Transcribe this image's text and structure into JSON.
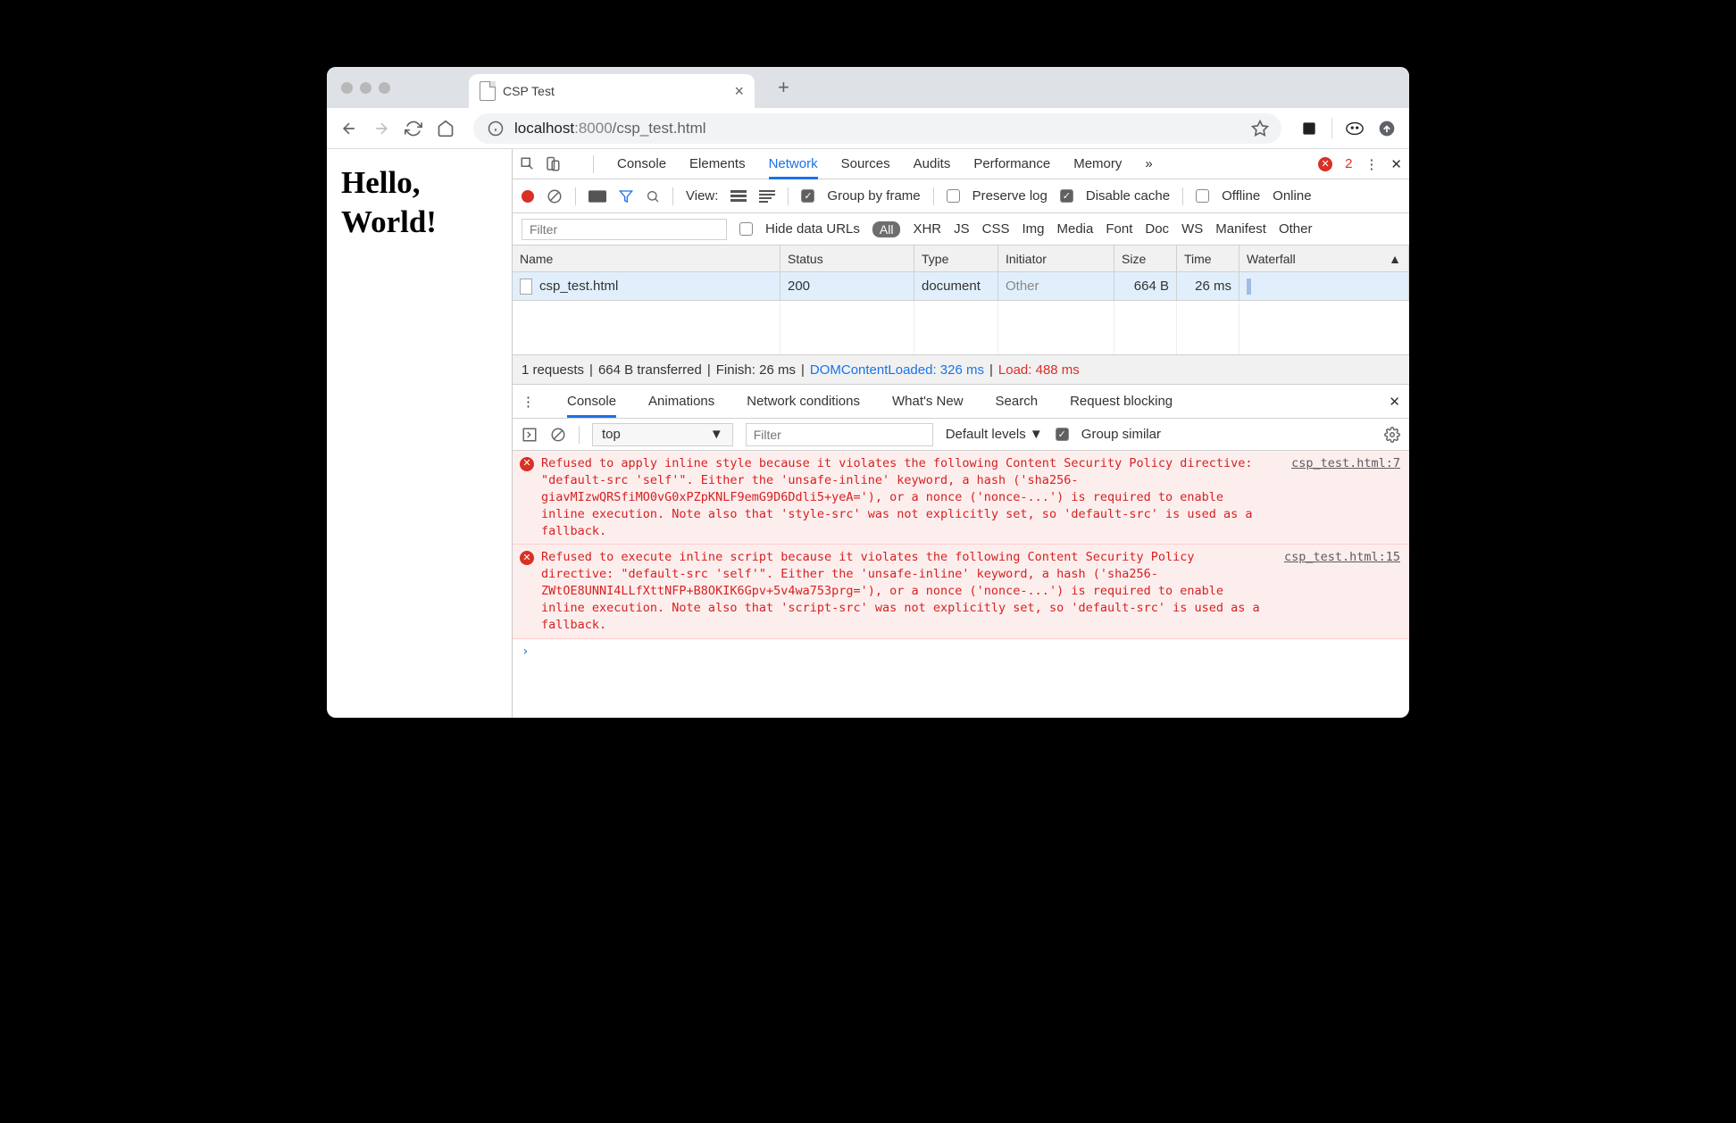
{
  "tab": {
    "title": "CSP Test"
  },
  "address": {
    "host": "localhost",
    "port": ":8000",
    "path": "/csp_test.html"
  },
  "page": {
    "heading_line1": "Hello,",
    "heading_line2": "World!"
  },
  "devtools": {
    "tabs": [
      "Console",
      "Elements",
      "Network",
      "Sources",
      "Audits",
      "Performance",
      "Memory"
    ],
    "selected_tab": "Network",
    "error_count": "2"
  },
  "net_toolbar": {
    "view_label": "View:",
    "group_by_frame": "Group by frame",
    "preserve_log": "Preserve log",
    "disable_cache": "Disable cache",
    "offline": "Offline",
    "online": "Online"
  },
  "net_filter": {
    "placeholder": "Filter",
    "hide_urls": "Hide data URLs",
    "all": "All",
    "types": [
      "XHR",
      "JS",
      "CSS",
      "Img",
      "Media",
      "Font",
      "Doc",
      "WS",
      "Manifest",
      "Other"
    ]
  },
  "net_headers": {
    "name": "Name",
    "status": "Status",
    "type": "Type",
    "initiator": "Initiator",
    "size": "Size",
    "time": "Time",
    "waterfall": "Waterfall"
  },
  "net_rows": [
    {
      "name": "csp_test.html",
      "status": "200",
      "type": "document",
      "initiator": "Other",
      "size": "664 B",
      "time": "26 ms"
    }
  ],
  "net_summary": {
    "requests": "1 requests",
    "transferred": "664 B transferred",
    "finish": "Finish: 26 ms",
    "dcl": "DOMContentLoaded: 326 ms",
    "load": "Load: 488 ms"
  },
  "drawer": {
    "tabs": [
      "Console",
      "Animations",
      "Network conditions",
      "What's New",
      "Search",
      "Request blocking"
    ]
  },
  "console_toolbar": {
    "context": "top",
    "filter_placeholder": "Filter",
    "levels": "Default levels ▼",
    "group_similar": "Group similar"
  },
  "console_errors": [
    {
      "msg": "Refused to apply inline style because it violates the following Content Security Policy directive: \"default-src 'self'\". Either the 'unsafe-inline' keyword, a hash ('sha256-giavMIzwQRSfiMO0vG0xPZpKNLF9emG9D6Ddli5+yeA='), or a nonce ('nonce-...') is required to enable inline execution. Note also that 'style-src' was not explicitly set, so 'default-src' is used as a fallback.",
      "src": "csp_test.html:7"
    },
    {
      "msg": "Refused to execute inline script because it violates the following Content Security Policy directive: \"default-src 'self'\". Either the 'unsafe-inline' keyword, a hash ('sha256-ZWtOE8UNNI4LLfXttNFP+B8OKIK6Gpv+5v4wa753prg='), or a nonce ('nonce-...') is required to enable inline execution. Note also that 'script-src' was not explicitly set, so 'default-src' is used as a fallback.",
      "src": "csp_test.html:15"
    }
  ]
}
